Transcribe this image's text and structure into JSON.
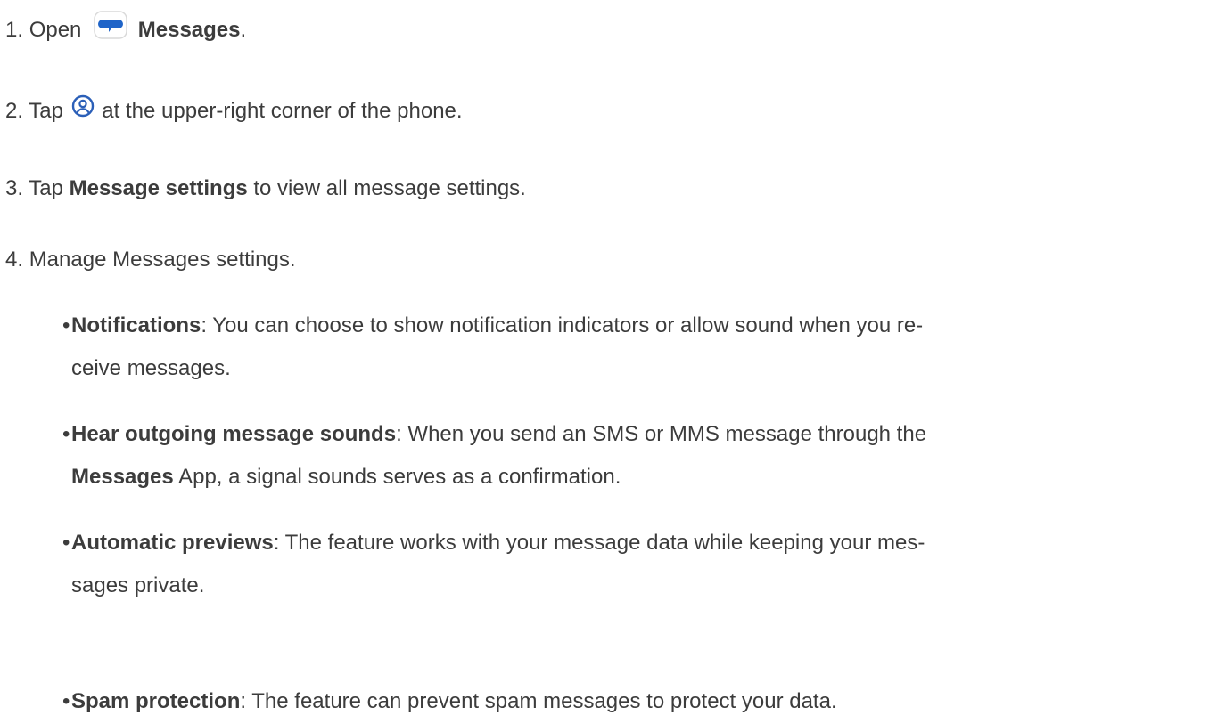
{
  "steps": [
    {
      "num": "1.",
      "pre": "Open",
      "icon": "messages-app-icon",
      "bold": "Messages",
      "post": "."
    },
    {
      "num": "2.",
      "pre": "Tap",
      "icon": "profile-account-icon",
      "post": "at the upper-right corner of the phone."
    },
    {
      "num": "3.",
      "pre": "Tap",
      "bold": "Message settings",
      "post": "to view all message settings."
    },
    {
      "num": "4.",
      "pre": "Manage Messages settings."
    }
  ],
  "bullets": [
    {
      "bold": "Notifications",
      "text": ": You can choose to show notification indicators or allow sound when you re-",
      "cont": "ceive messages."
    },
    {
      "bold": "Hear outgoing message sounds",
      "text": ": When you send an SMS or MMS message through the",
      "cont_bold": "Messages",
      "cont": " App, a signal sounds serves as a confirmation."
    },
    {
      "bold": "Automatic previews",
      "text": ": The feature works with your message data while keeping your mes-",
      "cont": "sages private."
    },
    {
      "bold": "Spam protection",
      "text": ": The feature can prevent spam messages to protect your data."
    }
  ],
  "colors": {
    "text": "#3c3c3c",
    "messages_icon_blue": "#1f64c8",
    "profile_icon_blue": "#2b5fb8"
  }
}
